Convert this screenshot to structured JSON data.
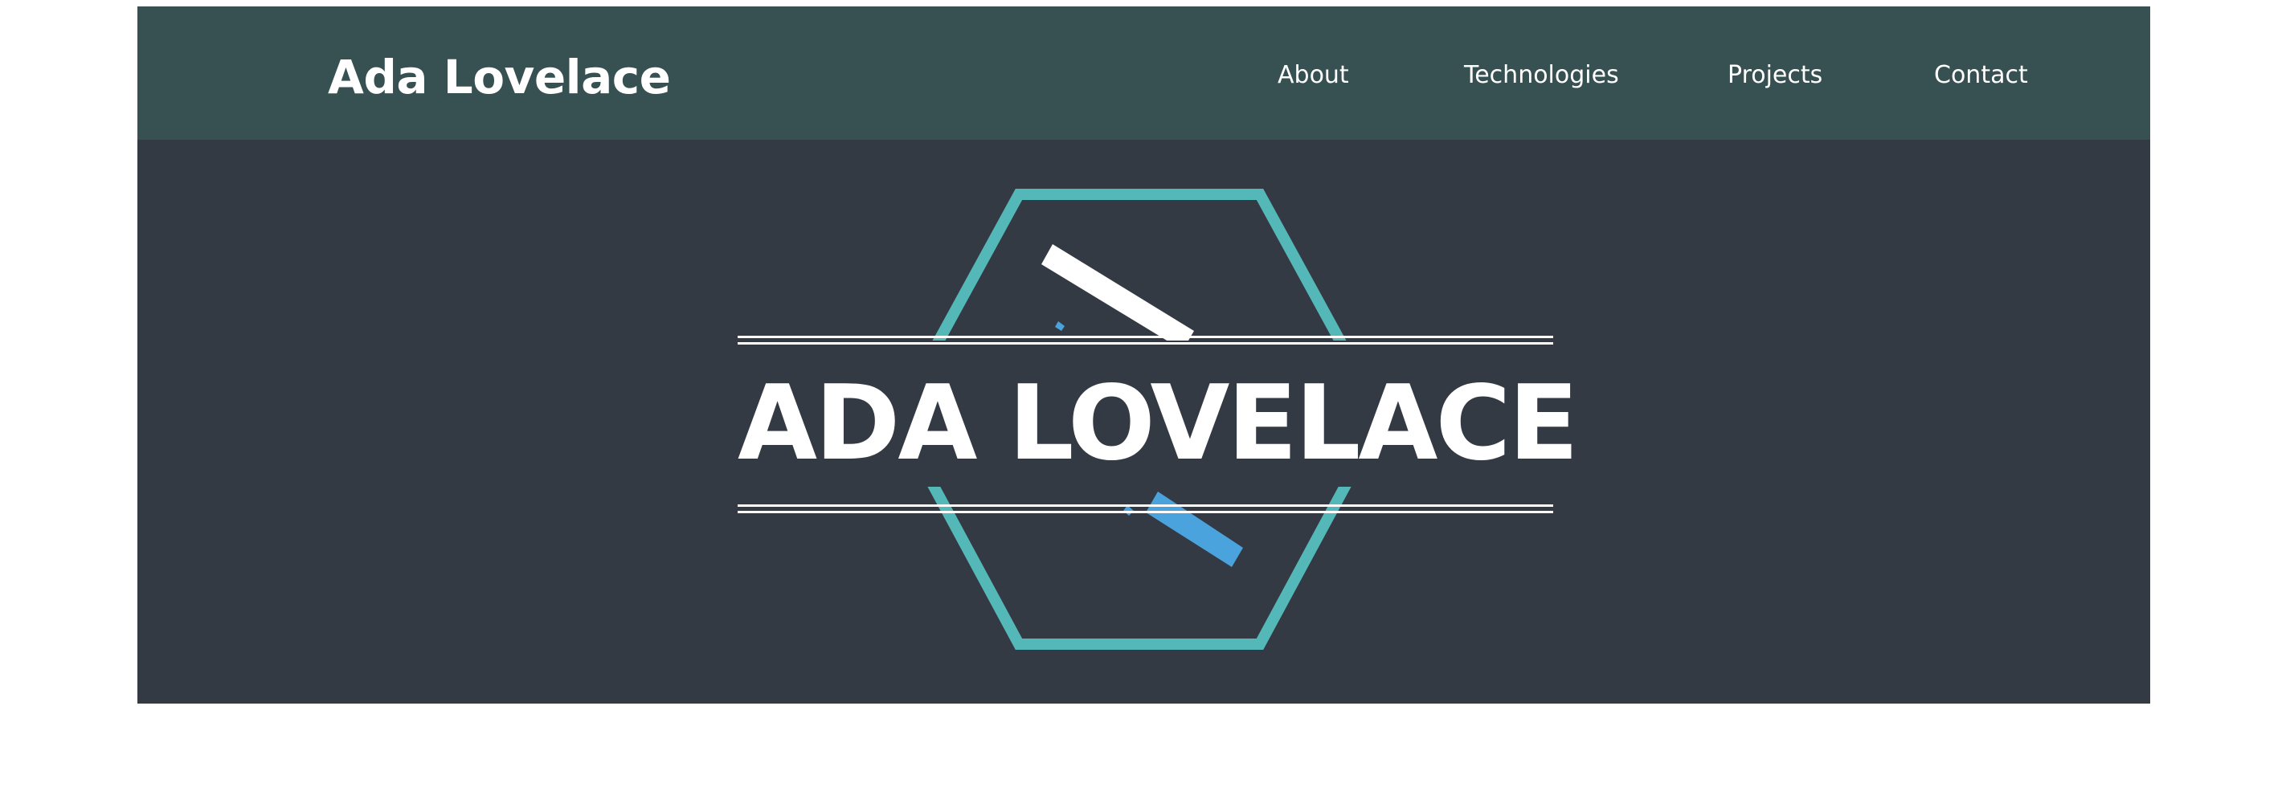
{
  "navbar": {
    "brand": "Ada Lovelace",
    "links": [
      {
        "label": "About"
      },
      {
        "label": "Technologies"
      },
      {
        "label": "Projects"
      },
      {
        "label": "Contact"
      }
    ]
  },
  "hero": {
    "title": "ADA LOVELACE",
    "logo_icon": "hexagon-logo-icon"
  },
  "colors": {
    "navbar_bg": "#375052",
    "hero_bg": "#343a44",
    "hexagon": "#55b8b8",
    "stripe_white": "#ffffff",
    "stripe_blue": "#4aa3dd",
    "text": "#ffffff"
  }
}
